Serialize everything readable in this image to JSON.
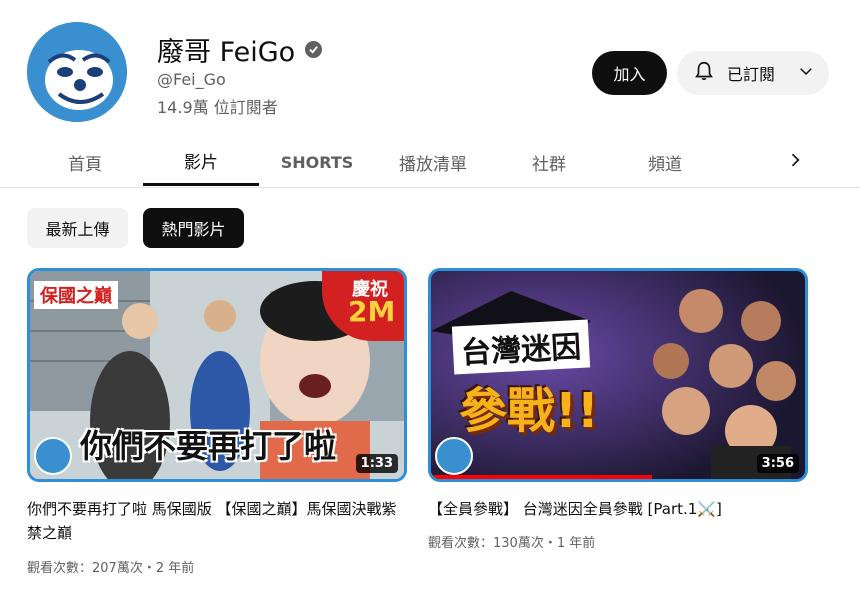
{
  "channel": {
    "name": "廢哥 FeiGo",
    "handle": "@Fei_Go",
    "subscribers": "14.9萬 位訂閱者",
    "avatar_icon": "feigo-face-logo",
    "verified_icon": "verified-check-icon"
  },
  "actions": {
    "join_label": "加入",
    "subscribed_label": "已訂閱"
  },
  "tabs": [
    {
      "label": "首頁",
      "active": false
    },
    {
      "label": "影片",
      "active": true
    },
    {
      "label": "SHORTS",
      "active": false
    },
    {
      "label": "播放清單",
      "active": false
    },
    {
      "label": "社群",
      "active": false
    },
    {
      "label": "頻道",
      "active": false
    }
  ],
  "chips": [
    {
      "label": "最新上傳",
      "selected": false
    },
    {
      "label": "熱門影片",
      "selected": true
    }
  ],
  "videos": [
    {
      "title": "你們不要再打了啦 馬保國版 【保國之巔】馬保國決戰紫禁之巔",
      "meta": "觀看次數：207萬次・2 年前",
      "duration": "1:33",
      "thumb_caption": "你們不要再打了啦",
      "thumb_tag": "保國之巔",
      "thumb_badge_line1": "慶祝",
      "thumb_badge_line2": "2M",
      "watched_fraction": 0
    },
    {
      "title": "【全員參戰】 台灣迷因全員參戰 [Part.1⚔️]",
      "meta": "觀看次數：130萬次・1 年前",
      "duration": "3:56",
      "thumb_line1": "台灣迷因",
      "thumb_line2": "參戰!!",
      "watched_fraction": 0.59
    }
  ],
  "colors": {
    "accent_blue": "#2e8fd6",
    "progress_red": "#ff0000",
    "badge_red": "#d32020"
  }
}
